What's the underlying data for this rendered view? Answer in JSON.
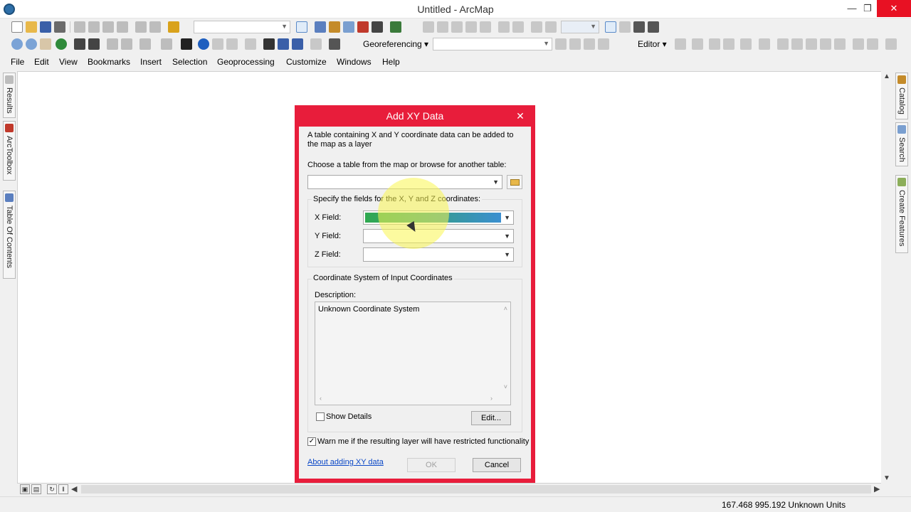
{
  "window": {
    "title": "Untitled - ArcMap",
    "minimize_glyph": "—",
    "maximize_glyph": "❐",
    "close_glyph": "✕"
  },
  "toolbar": {
    "georeferencing_label": "Georeferencing ▾",
    "editor_label": "Editor ▾"
  },
  "menu": {
    "items": [
      "File",
      "Edit",
      "View",
      "Bookmarks",
      "Insert",
      "Selection",
      "Geoprocessing",
      "Customize",
      "Windows",
      "Help"
    ]
  },
  "left_dock": {
    "tabs": [
      "Results",
      "ArcToolbox",
      "Table Of Contents"
    ]
  },
  "right_dock": {
    "tabs": [
      "Catalog",
      "Search",
      "Create Features"
    ]
  },
  "status": {
    "coordinates": "167.468  995.192 Unknown Units"
  },
  "dialog": {
    "title": "Add XY Data",
    "close_glyph": "✕",
    "intro_text": "A table containing X and Y coordinate data can be added to the map as a layer",
    "choose_label": "Choose a table from the map or browse for another table:",
    "table_value": "",
    "fields_group_label": "Specify the fields for the X, Y and Z coordinates:",
    "x_field_label": "X Field:",
    "y_field_label": "Y Field:",
    "z_field_label": "Z Field:",
    "x_field_value": "",
    "y_field_value": "",
    "z_field_value": "",
    "coord_group_label": "Coordinate System of Input Coordinates",
    "description_label": "Description:",
    "description_text": "Unknown Coordinate System",
    "show_details_label": "Show Details",
    "show_details_checked": false,
    "edit_button": "Edit...",
    "warn_label": "Warn me if the resulting layer will have restricted functionality",
    "warn_checked": true,
    "about_link": "About adding XY data",
    "ok_button": "OK",
    "cancel_button": "Cancel"
  },
  "colors": {
    "dialog_border": "#e81d3b",
    "close_button": "#e81123",
    "highlight_start": "#2fa84f",
    "highlight_end": "#3b8fd0",
    "link": "#0b48c7"
  }
}
